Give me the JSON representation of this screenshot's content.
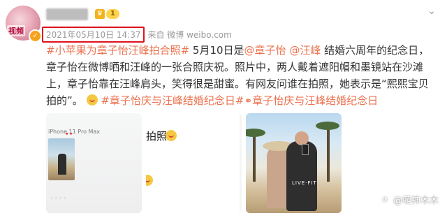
{
  "post": {
    "avatar_text": "视频",
    "timestamp": "2021年05月10日 14:37",
    "source": "来自 微博 weibo.com",
    "badge_level": "1",
    "segments": [
      {
        "type": "tag",
        "text": "#小苹果为章子怡汪峰拍合照#"
      },
      {
        "type": "text",
        "text": " 5月10日是"
      },
      {
        "type": "mention",
        "text": "@章子怡"
      },
      {
        "type": "text",
        "text": " "
      },
      {
        "type": "mention",
        "text": "@汪峰"
      },
      {
        "type": "text",
        "text": " 结婚六周年的纪念日，章子怡在微博晒和汪峰的一张合照庆祝。照片中，两人戴着遮阳帽和墨镜站在沙滩上，章子怡靠在汪峰肩头，笑得很是甜蜜。有网友问谁在拍照，她表示是“熙熙宝贝拍的”。"
      },
      {
        "type": "emoji",
        "text": ""
      },
      {
        "type": "text",
        "text": " "
      },
      {
        "type": "tag",
        "text": "#章子怡庆与汪峰结婚纪念日#"
      },
      {
        "type": "link",
        "text": "⚭"
      },
      {
        "type": "tag",
        "text": "章子怡庆与汪峰结婚纪念日"
      }
    ]
  },
  "images": {
    "t1_caption": "iPhone 11 Pro Max",
    "t2_text": "拍照",
    "t3_shirt": "LIVE·FIT"
  },
  "watermark": {
    "text": "@萌神木木"
  }
}
